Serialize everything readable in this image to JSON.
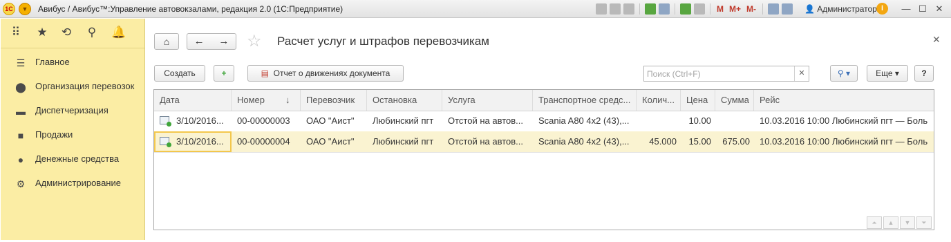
{
  "window": {
    "title": "Авибус / Авибус™:Управление автовокзалами, редакция 2.0  (1С:Предприятие)",
    "logo": "1С",
    "toolbar_letters": [
      "M",
      "M+",
      "M-"
    ],
    "user": "Администратор",
    "info": "i",
    "min": "—",
    "max": "☐",
    "close": "✕"
  },
  "sidebar": {
    "items": [
      {
        "label": "Главное",
        "icon": "list-icon"
      },
      {
        "label": "Организация перевозок",
        "icon": "location-pin-icon"
      },
      {
        "label": "Диспетчеризация",
        "icon": "bus-icon"
      },
      {
        "label": "Продажи",
        "icon": "shopping-bag-icon"
      },
      {
        "label": "Денежные средства",
        "icon": "ruble-coin-icon"
      },
      {
        "label": "Администрирование",
        "icon": "gear-icon"
      }
    ]
  },
  "doc": {
    "title": "Расчет услуг и штрафов перевозчикам",
    "create_label": "Создать",
    "report_label": "Отчет о движениях документа",
    "search_placeholder": "Поиск (Ctrl+F)",
    "more_label": "Еще",
    "help_label": "?"
  },
  "table": {
    "headers": [
      "Дата",
      "Номер",
      "Перевозчик",
      "Остановка",
      "Услуга",
      "Транспортное средс...",
      "Колич...",
      "Цена",
      "Сумма",
      "Рейс"
    ],
    "sort_arrow": "↓",
    "rows": [
      {
        "date": "3/10/2016...",
        "number": "00-00000003",
        "carrier": "ОАО \"Аист\"",
        "stop": "Любинский пгт",
        "service": "Отстой на автов...",
        "vehicle": "Scania A80 4x2 (43),...",
        "qty": "",
        "price": "10.00",
        "sum": "",
        "trip": "10.03.2016 10:00  Любинский пгт — Боль"
      },
      {
        "date": "3/10/2016...",
        "number": "00-00000004",
        "carrier": "ОАО \"Аист\"",
        "stop": "Любинский пгт",
        "service": "Отстой на автов...",
        "vehicle": "Scania A80 4x2 (43),...",
        "qty": "45.000",
        "price": "15.00",
        "sum": "675.00",
        "trip": "10.03.2016 10:00  Любинский пгт — Боль"
      }
    ]
  }
}
